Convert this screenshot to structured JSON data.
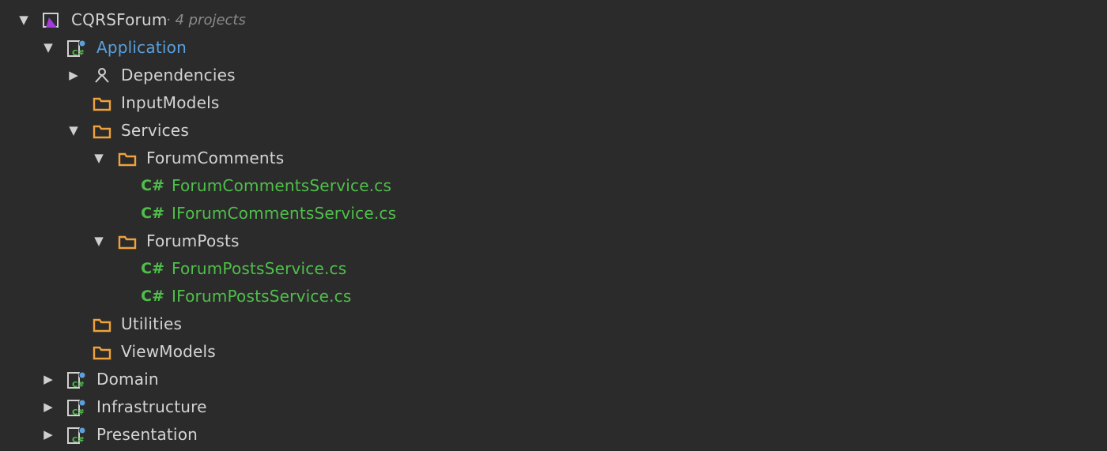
{
  "solution": {
    "name": "CQRSForum",
    "subtitle": "· 4 projects",
    "expanded": true
  },
  "icons": {
    "solution": "vs-solution-icon",
    "project": "csharp-project-icon",
    "dependencies": "dependencies-icon",
    "folder": "folder-icon",
    "csharp_file": "csharp-file-icon",
    "csharp_glyph": "C#"
  },
  "colors": {
    "background": "#2b2b2b",
    "folder": "#f0a23b",
    "csharp_file_text": "#4fbf4a",
    "selected_project_text": "#5aa0dc",
    "solution_icon": "#a23bd8"
  },
  "tree": [
    {
      "label": "Application",
      "type": "project",
      "expanded": true,
      "highlighted": true
    },
    {
      "label": "Dependencies",
      "type": "dependencies",
      "expanded": false
    },
    {
      "label": "InputModels",
      "type": "folder"
    },
    {
      "label": "Services",
      "type": "folder",
      "expanded": true
    },
    {
      "label": "ForumComments",
      "type": "folder",
      "expanded": true
    },
    {
      "label": "ForumCommentsService.cs",
      "type": "csfile"
    },
    {
      "label": "IForumCommentsService.cs",
      "type": "csfile"
    },
    {
      "label": "ForumPosts",
      "type": "folder",
      "expanded": true
    },
    {
      "label": "ForumPostsService.cs",
      "type": "csfile"
    },
    {
      "label": "IForumPostsService.cs",
      "type": "csfile"
    },
    {
      "label": "Utilities",
      "type": "folder"
    },
    {
      "label": "ViewModels",
      "type": "folder"
    },
    {
      "label": "Domain",
      "type": "project",
      "expanded": false
    },
    {
      "label": "Infrastructure",
      "type": "project",
      "expanded": false
    },
    {
      "label": "Presentation",
      "type": "project",
      "expanded": false
    }
  ]
}
